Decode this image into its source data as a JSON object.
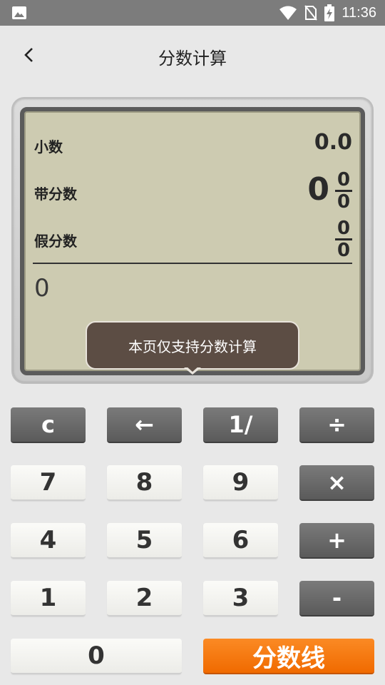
{
  "status_bar": {
    "time": "11:36"
  },
  "header": {
    "title": "分数计算"
  },
  "display": {
    "decimal_label": "小数",
    "decimal_value": "0.0",
    "mixed_label": "带分数",
    "mixed_whole": "0",
    "mixed_numerator": "0",
    "mixed_denominator": "0",
    "improper_label": "假分数",
    "improper_numerator": "0",
    "improper_denominator": "0",
    "input_value": "0"
  },
  "toast": {
    "text": "本页仅支持分数计算"
  },
  "keypad": {
    "clear": "c",
    "backspace": "←",
    "reciprocal": "1/",
    "divide": "÷",
    "seven": "7",
    "eight": "8",
    "nine": "9",
    "multiply": "×",
    "four": "4",
    "five": "5",
    "six": "6",
    "plus": "+",
    "one": "1",
    "two": "2",
    "three": "3",
    "minus": "-",
    "zero": "0",
    "fraction_line": "分数线"
  },
  "colors": {
    "accent": "#f47a10",
    "lcd_bg": "#cdcbb1",
    "toast_bg": "#5c4d44"
  }
}
